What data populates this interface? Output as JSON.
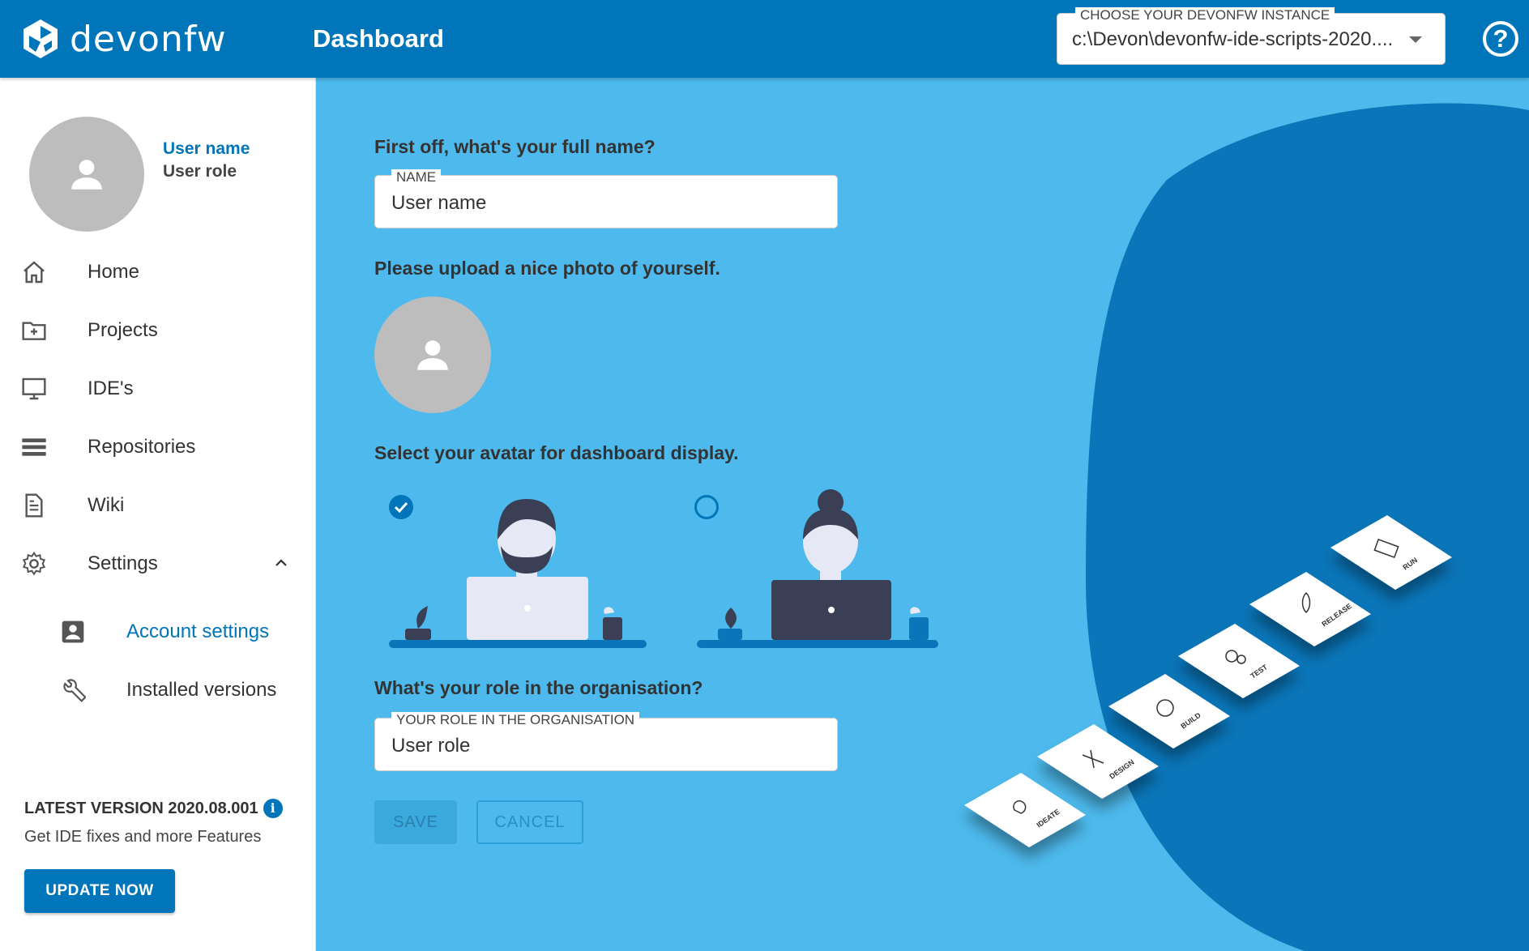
{
  "header": {
    "logo_text": "devonfw",
    "title": "Dashboard",
    "instance_label": "CHOOSE YOUR DEVONFW INSTANCE",
    "instance_value": "c:\\Devon\\devonfw-ide-scripts-2020....",
    "help_symbol": "?"
  },
  "sidebar": {
    "user_name": "User name",
    "user_role": "User role",
    "nav": [
      {
        "label": "Home",
        "icon": "home-icon"
      },
      {
        "label": "Projects",
        "icon": "folder-add-icon"
      },
      {
        "label": "IDE's",
        "icon": "monitor-icon"
      },
      {
        "label": "Repositories",
        "icon": "list-icon"
      },
      {
        "label": "Wiki",
        "icon": "document-icon"
      },
      {
        "label": "Settings",
        "icon": "gear-icon"
      }
    ],
    "sub": [
      {
        "label": "Account settings",
        "icon": "account-box-icon"
      },
      {
        "label": "Installed versions",
        "icon": "wrench-icon"
      }
    ],
    "latest_version": "LATEST VERSION 2020.08.001",
    "latest_sub": "Get IDE fixes and more Features",
    "update_label": "UPDATE NOW"
  },
  "form": {
    "q_name": "First off, what's your full name?",
    "name_label": "NAME",
    "name_value": "User name",
    "q_photo": "Please upload a nice photo of yourself.",
    "q_avatar": "Select your avatar for dashboard display.",
    "q_role": "What's your role in the organisation?",
    "role_label": "YOUR ROLE IN THE ORGANISATION",
    "role_value": "User role",
    "save_label": "SAVE",
    "cancel_label": "CANCEL"
  },
  "tiles": [
    "IDEATE",
    "DESIGN",
    "BUILD",
    "TEST",
    "RELEASE",
    "RUN"
  ],
  "colors": {
    "brand": "#0075b9",
    "main_bg": "#4db9ec",
    "blob": "#0a75b8"
  }
}
